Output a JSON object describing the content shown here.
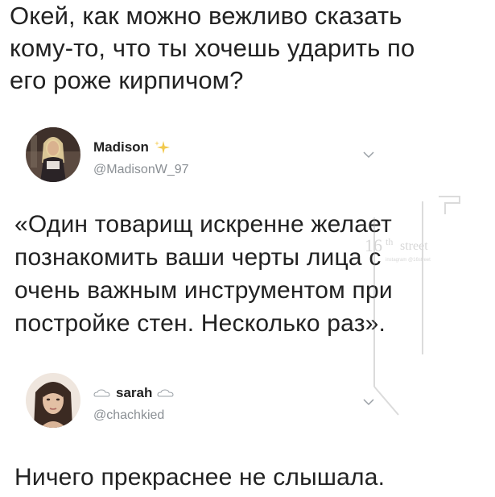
{
  "question": {
    "line1": "Окей, как можно вежливо сказать",
    "line2": "кому-то, что ты хочешь ударить по",
    "line3": "его роже кирпичом?"
  },
  "tweets": [
    {
      "display_name": "Madison",
      "handle": "@MadisonW_97",
      "body_lines": [
        "«Один товарищ  искренне желает",
        "познакомить ваши черты лица с",
        "очень важным инструментом при",
        "постройке стен. Несколько раз»."
      ],
      "avatar_icon": "profile-photo",
      "name_badge_icon": "sparkle-icon",
      "menu_icon": "chevron-down-icon"
    },
    {
      "display_name": "sarah",
      "handle": "@chachkied",
      "body_lines": [
        "Ничего прекраснее не слышала."
      ],
      "avatar_icon": "profile-photo",
      "name_badge_icon": "cloud-icon",
      "menu_icon": "chevron-down-icon"
    }
  ],
  "watermark": {
    "text_main": "16th street",
    "text_small": "instagram @16street"
  },
  "colors": {
    "text": "#222222",
    "handle": "#8a8f94",
    "sparkle": "#f2c94c",
    "background": "#ffffff"
  }
}
